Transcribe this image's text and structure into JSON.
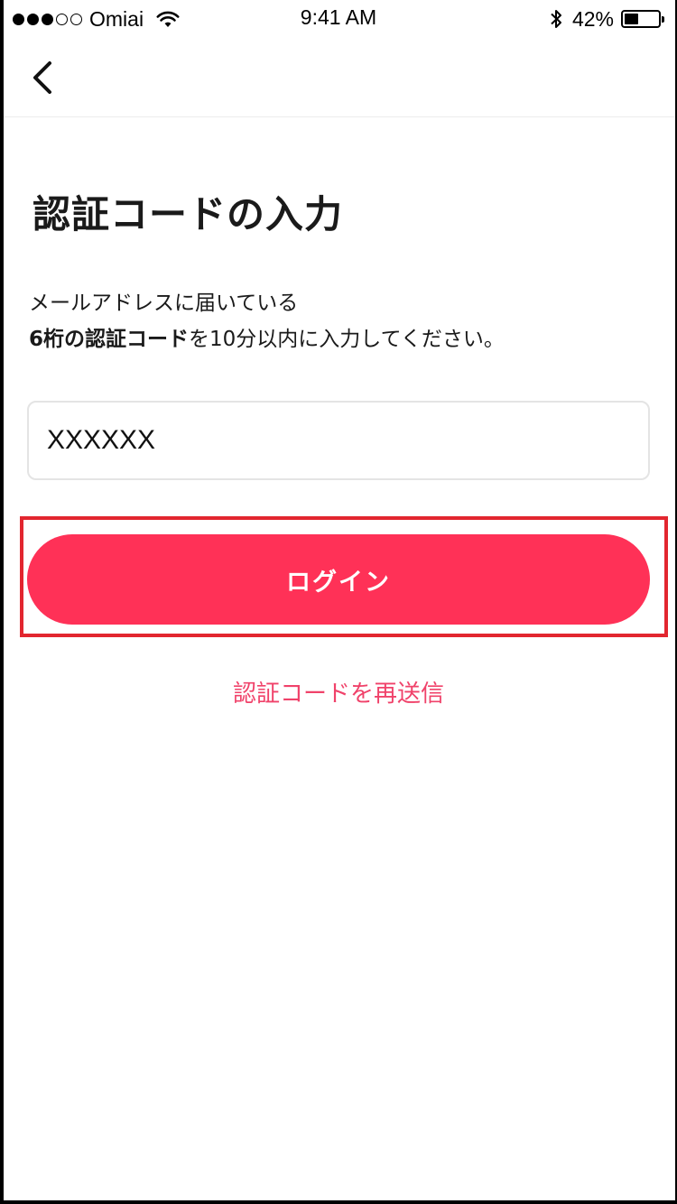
{
  "status_bar": {
    "carrier": "Omiai",
    "time": "9:41 AM",
    "battery_percent": "42%",
    "battery_level": 0.42,
    "signal_bars_full": 3,
    "signal_bars_total": 5
  },
  "nav": {
    "back_icon": "chevron-left-icon"
  },
  "page": {
    "title": "認証コードの入力",
    "desc_line1": "メールアドレスに届いている",
    "desc_line2_bold": "6桁の認証コード",
    "desc_line2_rest": "を10分以内に入力してください。"
  },
  "form": {
    "code_value": "XXXXXX",
    "login_label": "ログイン",
    "resend_label": "認証コードを再送信"
  },
  "colors": {
    "accent": "#ff3157",
    "link": "#f0426a",
    "highlight": "#e2262f"
  }
}
